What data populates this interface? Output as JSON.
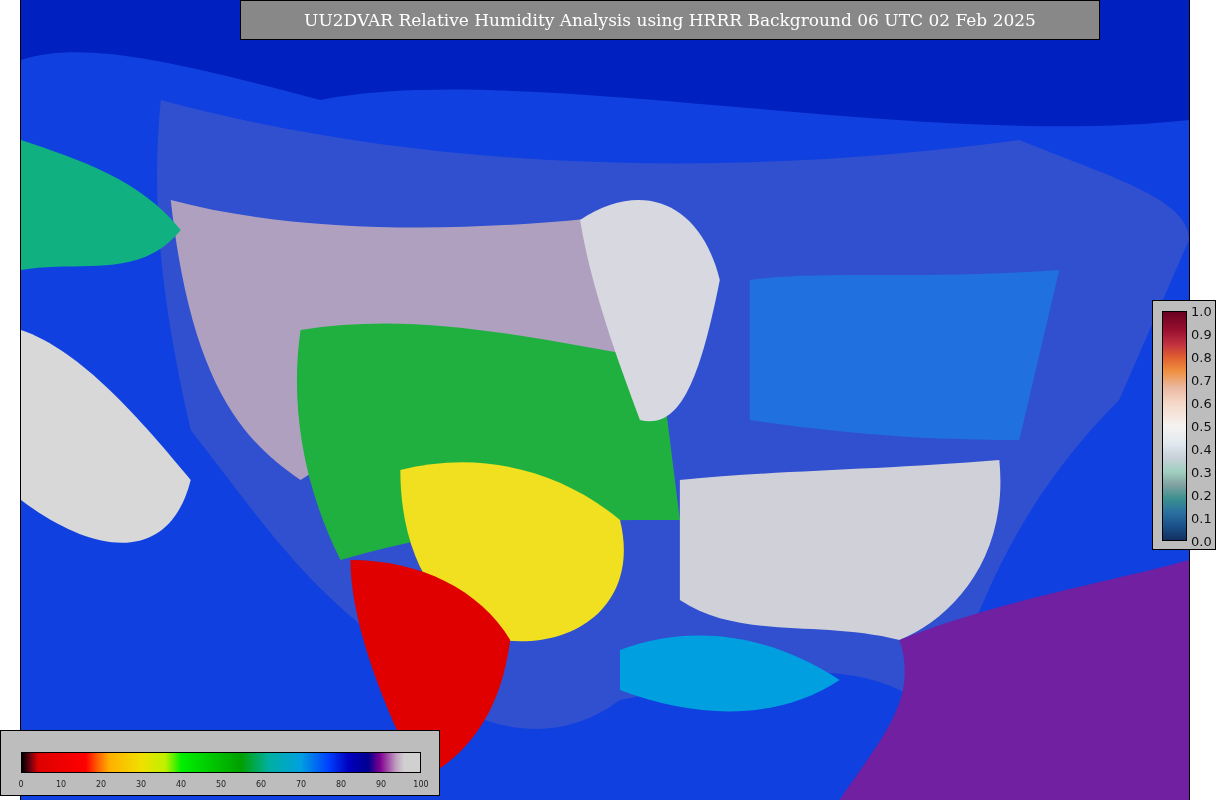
{
  "title": "UU2DVAR Relative Humidity Analysis using HRRR Background 06 UTC 02 Feb 2025",
  "humidity_colorbar": {
    "ticks": [
      "0",
      "10",
      "20",
      "30",
      "40",
      "50",
      "60",
      "70",
      "80",
      "90",
      "100"
    ]
  },
  "observation_colorbar": {
    "ticks": [
      "1.0",
      "0.9",
      "0.8",
      "0.7",
      "0.6",
      "0.5",
      "0.4",
      "0.3",
      "0.2",
      "0.1",
      "0.0"
    ]
  }
}
